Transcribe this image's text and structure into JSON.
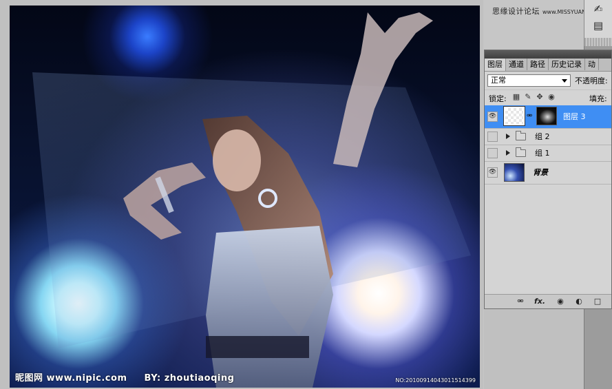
{
  "watermarks": {
    "site_cn": "思缘设计论坛",
    "site_url": "www.MISSYUAN.COM",
    "brand": "昵图网",
    "brand_url": "www.nipic.com",
    "author": "BY: zhoutiaoqing",
    "image_no": "NO:20100914043011514399"
  },
  "tool_dock": {
    "icons": [
      "stamp-tool-icon",
      "clone-source-icon"
    ]
  },
  "layers_panel": {
    "tabs": [
      {
        "label": "图层",
        "active": true
      },
      {
        "label": "通道",
        "active": false
      },
      {
        "label": "路径",
        "active": false
      },
      {
        "label": "历史记录",
        "active": false
      },
      {
        "label": "动",
        "active": false
      }
    ],
    "blend_mode": "正常",
    "opacity_label": "不透明度:",
    "lock_label": "锁定:",
    "fill_label": "填充:",
    "layers": [
      {
        "name": "图层 3",
        "visible": true,
        "selected": true,
        "type": "layer-with-mask"
      },
      {
        "name": "组 2",
        "visible": false,
        "selected": false,
        "type": "group"
      },
      {
        "name": "组 1",
        "visible": false,
        "selected": false,
        "type": "group"
      },
      {
        "name": "背景",
        "visible": true,
        "selected": false,
        "type": "background"
      }
    ],
    "bottom_icons": [
      "link-icon",
      "fx-icon",
      "mask-icon",
      "adjustment-icon",
      "new-group-icon"
    ],
    "fx_text": "fx."
  },
  "colors": {
    "selected_layer": "#3f8ef3",
    "panel_bg": "#d4d4d4",
    "workspace": "#c0c0c0"
  }
}
